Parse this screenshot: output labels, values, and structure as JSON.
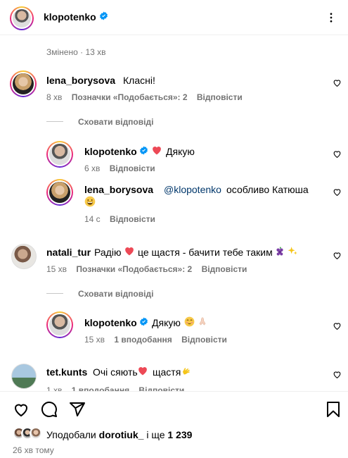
{
  "post_author": {
    "username": "klopotenko"
  },
  "edited_line": {
    "prefix": "Змінено",
    "time": "13 хв",
    "separator": "·"
  },
  "comments": [
    {
      "username": "lena_borysova",
      "text": "Класні!",
      "time": "8 хв",
      "likes": "Позначки «Подобається»: 2",
      "reply": "Відповісти",
      "hide_replies": "Сховати відповіді",
      "replies": [
        {
          "username": "klopotenko",
          "text": "Дякую",
          "time": "6 хв",
          "reply": "Відповісти"
        },
        {
          "username": "lena_borysova",
          "mention": "@klopotenko",
          "text": "особливо Катюша",
          "time": "14 с",
          "reply": "Відповісти"
        }
      ]
    },
    {
      "username": "natali_tur",
      "text_before": "Радію",
      "text_after": "це щастя - бачити тебе таким",
      "time": "15 хв",
      "likes": "Позначки «Подобається»: 2",
      "reply": "Відповісти",
      "hide_replies": "Сховати відповіді",
      "replies": [
        {
          "username": "klopotenko",
          "text": "Дякую",
          "time": "15 хв",
          "likes": "1 вподобання",
          "reply": "Відповісти"
        }
      ]
    },
    {
      "username": "tet.kunts",
      "text_before": "Очі сяють",
      "text_after": "щастя",
      "time": "1 хв",
      "likes": "1 вподобання",
      "reply": "Відповісти"
    }
  ],
  "footer": {
    "liked_prefix": "Уподобали",
    "liked_user": "dorotiuk_",
    "liked_suffix": "і ще",
    "liked_count": "1 239",
    "timestamp": "26 хв тому"
  },
  "colors": {
    "accent_heart": "#ed4956",
    "verified": "#0095f6",
    "muted": "#737373",
    "mention": "#00376b"
  },
  "icons": [
    "more-icon",
    "heart-icon",
    "comment-icon",
    "share-icon",
    "bookmark-icon",
    "verified-icon"
  ]
}
